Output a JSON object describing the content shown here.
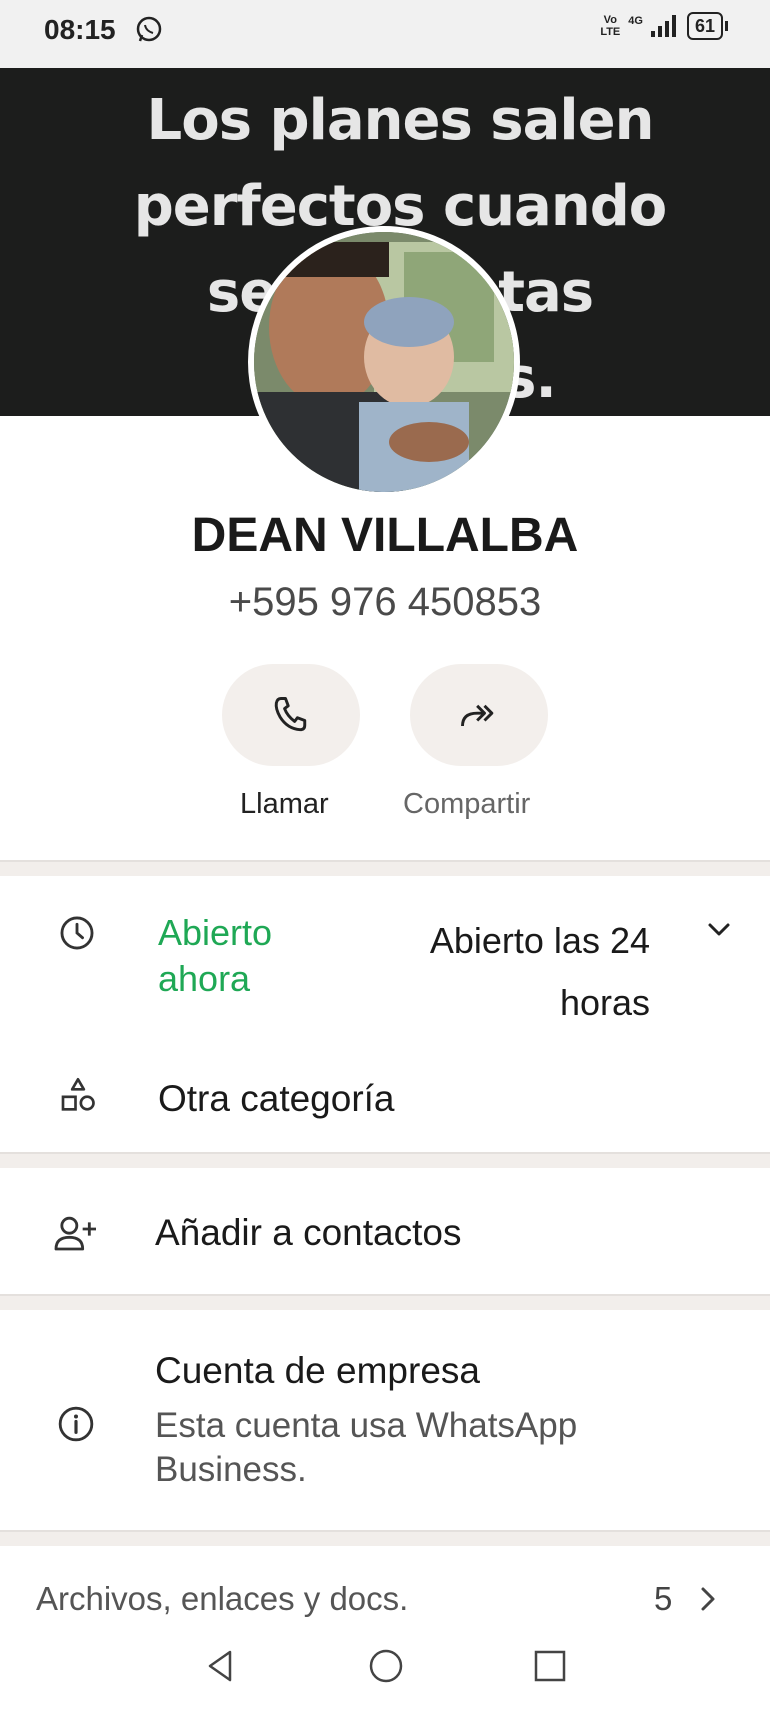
{
  "status_bar": {
    "time": "08:15",
    "volte": "Vo LTE",
    "network": "4G",
    "battery": "61"
  },
  "cover": {
    "caption_visible": "Los planes salen perfectos cuando se [obscured] tas [obscured] s."
  },
  "contact": {
    "name": "DEAN VILLALBA",
    "phone": "+595 976 450853"
  },
  "actions": {
    "call_label": "Llamar",
    "share_label": "Compartir"
  },
  "business_hours": {
    "status": "Abierto ahora",
    "detail": "Abierto las 24 horas"
  },
  "category": {
    "label": "Otra categoría"
  },
  "add_contact": {
    "label": "Añadir a contactos"
  },
  "business_account": {
    "title": "Cuenta de empresa",
    "description": "Esta cuenta usa WhatsApp Business."
  },
  "media": {
    "label": "Archivos, enlaces y docs.",
    "count": "5"
  },
  "colors": {
    "open_green": "#1fa855",
    "button_bg": "#f3efec",
    "cover_bg": "#1c1d1c"
  }
}
